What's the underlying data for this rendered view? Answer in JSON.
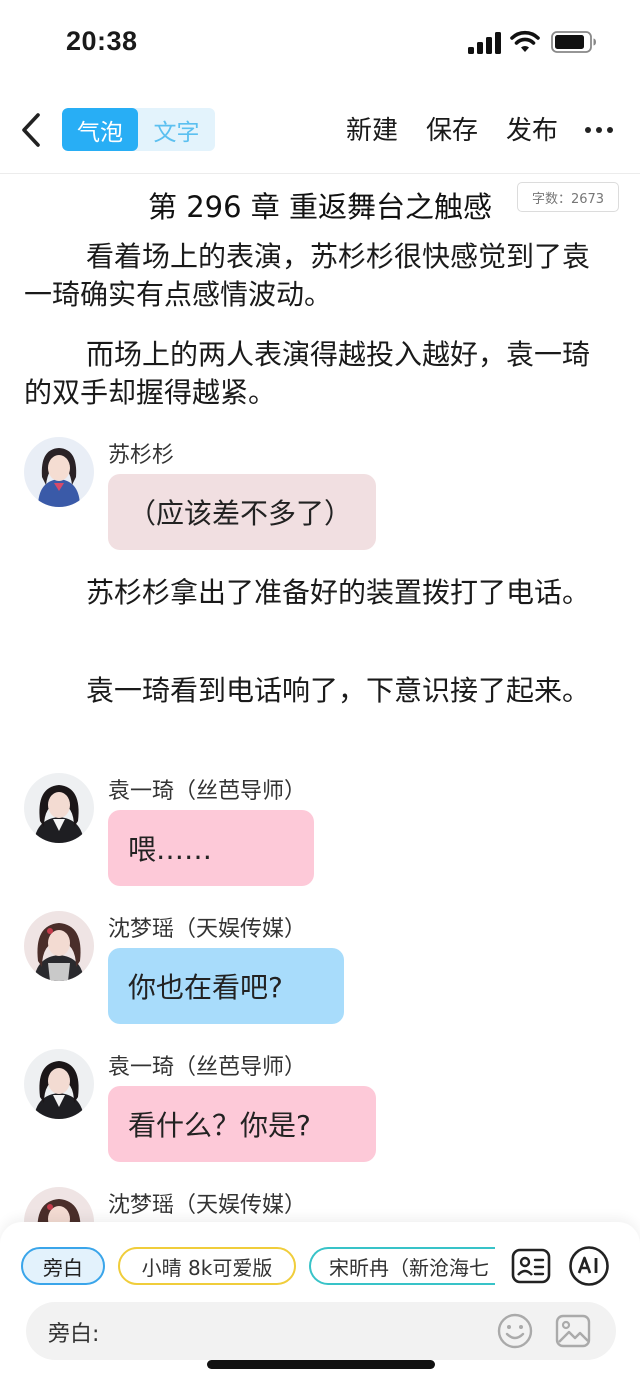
{
  "status_bar": {
    "time": "20:38"
  },
  "header": {
    "mode_bubble": "气泡",
    "mode_text": "文字",
    "new_label": "新建",
    "save_label": "保存",
    "publish_label": "发布"
  },
  "chapter": {
    "title": "第 296 章 重返舞台之触感",
    "word_count": "字数：2673"
  },
  "paragraphs": [
    "看着场上的表演，苏杉杉很快感觉到了袁一琦确实有点感情波动。",
    "而场上的两人表演得越投入越好，袁一琦的双手却握得越紧。",
    "苏杉杉拿出了准备好的装置拨打了电话。",
    "袁一琦看到电话响了，下意识接了起来。"
  ],
  "messages": [
    {
      "speaker": "苏杉杉",
      "text": "（应该差不多了）",
      "color": "#f1dfe1"
    },
    {
      "speaker": "袁一琦（丝芭导师）",
      "text": "喂……",
      "color": "#fdc9d8"
    },
    {
      "speaker": "沈梦瑶（天娱传媒）",
      "text": "你也在看吧?",
      "color": "#a8dcfb"
    },
    {
      "speaker": "袁一琦（丝芭导师）",
      "text": "看什么？你是?",
      "color": "#fdc9d8"
    },
    {
      "speaker": "沈梦瑶（天娱传媒）"
    }
  ],
  "roles": {
    "narration": "旁白",
    "xiaoqing": "小晴 8k可爱版",
    "song": "宋昕冉（新沧海七"
  },
  "input": {
    "label": "旁白:"
  },
  "icons": {
    "back": "chevron-left-icon",
    "more": "more-dots-icon",
    "roles": "role-list-icon",
    "ai": "ai-icon",
    "emoji": "emoji-icon",
    "image": "image-icon"
  },
  "colors": {
    "accent": "#28aef5",
    "narration_chip": "#3aa5ea",
    "xiaoqing_chip": "#f0cd3b",
    "song_chip": "#38c3c8"
  }
}
